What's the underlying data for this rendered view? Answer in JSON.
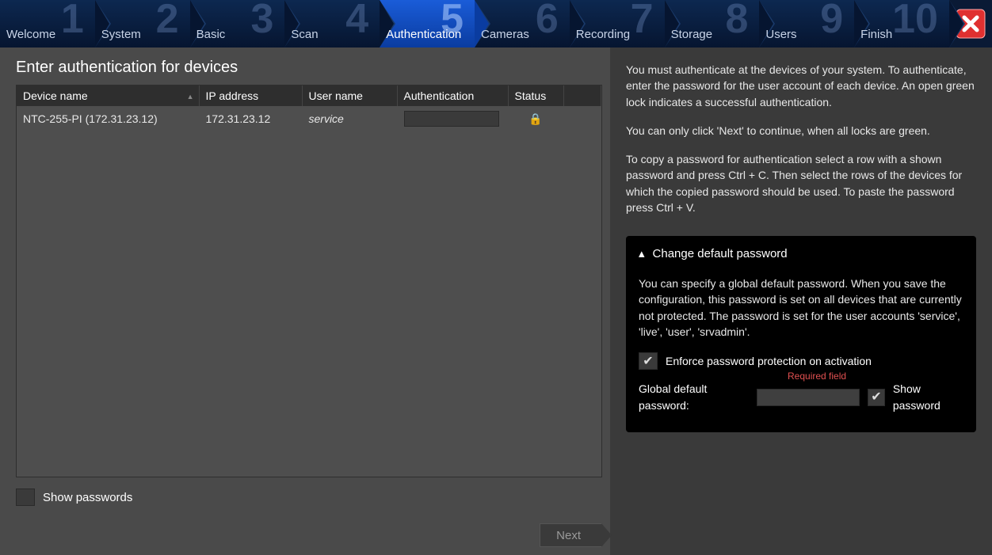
{
  "steps": [
    {
      "num": "1",
      "label": "Welcome"
    },
    {
      "num": "2",
      "label": "System"
    },
    {
      "num": "3",
      "label": "Basic"
    },
    {
      "num": "4",
      "label": "Scan"
    },
    {
      "num": "5",
      "label": "Authentication"
    },
    {
      "num": "6",
      "label": "Cameras"
    },
    {
      "num": "7",
      "label": "Recording"
    },
    {
      "num": "8",
      "label": "Storage"
    },
    {
      "num": "9",
      "label": "Users"
    },
    {
      "num": "10",
      "label": "Finish"
    }
  ],
  "active_step_index": 4,
  "page_title": "Enter authentication for devices",
  "table": {
    "headers": {
      "device": "Device name",
      "ip": "IP address",
      "user": "User name",
      "auth": "Authentication",
      "status": "Status"
    },
    "rows": [
      {
        "device": "NTC-255-PI (172.31.23.12)",
        "ip": "172.31.23.12",
        "user": "service",
        "auth": "",
        "status": "locked"
      }
    ]
  },
  "show_passwords_label": "Show passwords",
  "next_label": "Next",
  "help": {
    "p1": "You must authenticate at the devices of your system. To authenticate, enter the password for the user account of each device. An open green lock indicates a successful authentication.",
    "p2": "You can only click 'Next' to continue, when all locks are green.",
    "p3": "To copy a password for authentication select a row with a shown password and press Ctrl + C. Then select the rows of the devices for which the copied password should be used. To paste the password press Ctrl + V."
  },
  "panel": {
    "title": "Change default password",
    "desc": "You can specify a global default password. When you save the configuration, this password is set on all devices that are currently not protected. The password is set for the user accounts 'service', 'live', 'user', 'srvadmin'.",
    "enforce_label": "Enforce password protection on activation",
    "global_pw_label": "Global default password:",
    "required_label": "Required field",
    "show_pw_label": "Show password"
  }
}
